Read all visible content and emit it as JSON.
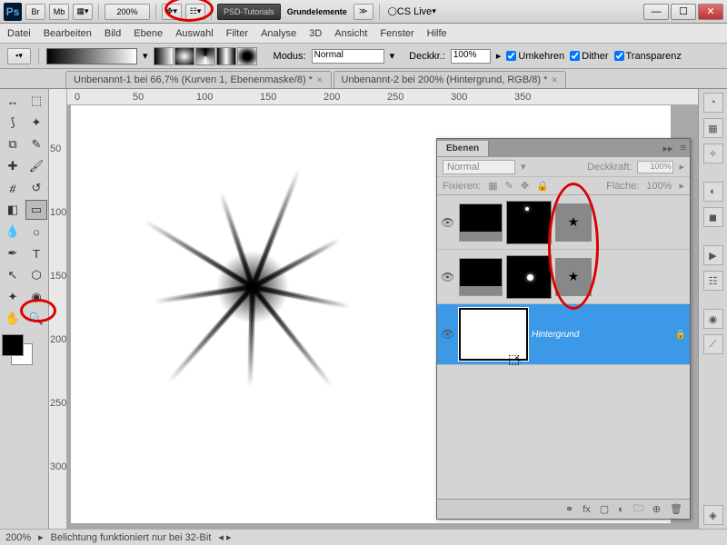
{
  "title": {
    "app": "Ps",
    "zoom": "200%",
    "doc_group": "PSD-Tutorials",
    "doc_name": "Grundelemente",
    "cslive": "CS Live"
  },
  "menu": [
    "Datei",
    "Bearbeiten",
    "Bild",
    "Ebene",
    "Auswahl",
    "Filter",
    "Analyse",
    "3D",
    "Ansicht",
    "Fenster",
    "Hilfe"
  ],
  "opt": {
    "mode_label": "Modus:",
    "mode_value": "Normal",
    "opacity_label": "Deckkr.:",
    "opacity_value": "100%",
    "cb1": "Umkehren",
    "cb2": "Dither",
    "cb3": "Transparenz"
  },
  "tabs": [
    "Unbenannt-1 bei 66,7% (Kurven 1, Ebenenmaske/8) *",
    "Unbenannt-2 bei 200% (Hintergrund, RGB/8) *"
  ],
  "ruler_top": [
    "0",
    "50",
    "100",
    "150",
    "200",
    "250",
    "300",
    "350"
  ],
  "ruler_left": [
    "50",
    "100",
    "150",
    "200",
    "250",
    "300"
  ],
  "layers": {
    "panel_title": "Ebenen",
    "blend": "Normal",
    "opacity_label": "Deckkraft:",
    "opacity_value": "100%",
    "lock_label": "Fixieren:",
    "fill_label": "Fläche:",
    "fill_value": "100%",
    "bg_name": "Hintergrund"
  },
  "status": {
    "zoom": "200%",
    "msg": "Belichtung funktioniert nur bei 32-Bit"
  }
}
